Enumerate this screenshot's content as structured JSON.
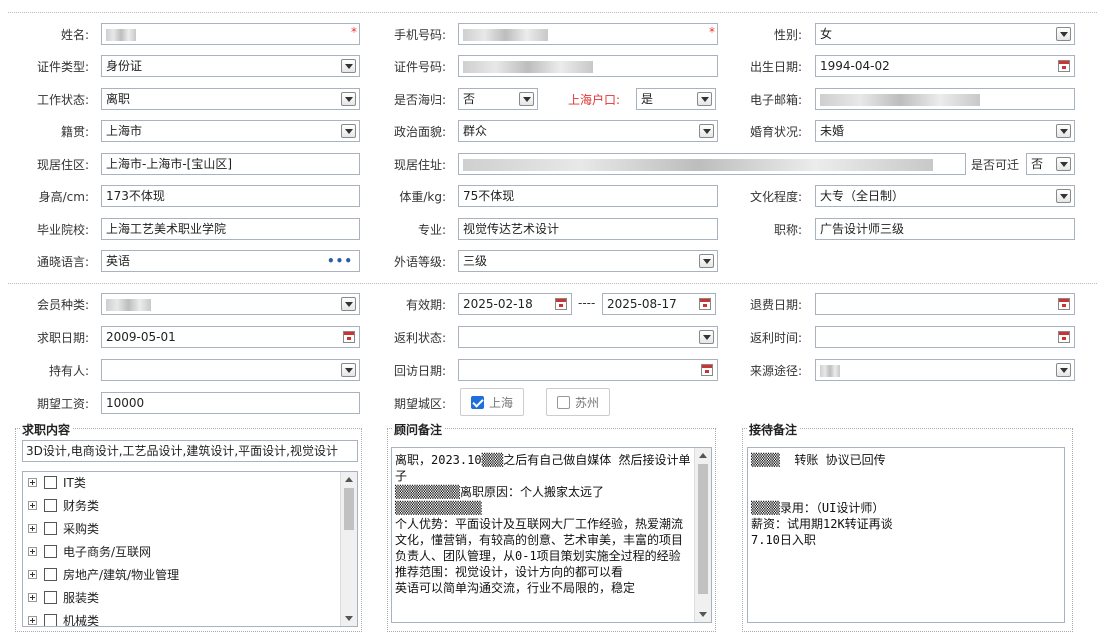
{
  "personal": {
    "name": {
      "label": "姓名:"
    },
    "phone": {
      "label": "手机号码:"
    },
    "gender": {
      "label": "性别:",
      "value": "女"
    },
    "id_type": {
      "label": "证件类型:",
      "value": "身份证"
    },
    "id_no": {
      "label": "证件号码:"
    },
    "birth": {
      "label": "出生日期:",
      "value": "1994-04-02"
    },
    "work_status": {
      "label": "工作状态:",
      "value": "离职"
    },
    "overseas": {
      "label": "是否海归:",
      "value": "否"
    },
    "sh_hukou": {
      "label": "上海户口:",
      "value": "是"
    },
    "email": {
      "label": "电子邮箱:"
    },
    "native": {
      "label": "籍贯:",
      "value": "上海市"
    },
    "politics": {
      "label": "政治面貌:",
      "value": "群众"
    },
    "marital": {
      "label": "婚育状况:",
      "value": "未婚"
    },
    "residence": {
      "label": "现居住区:",
      "value": "上海市-上海市-[宝山区]"
    },
    "address": {
      "label": "现居住址:"
    },
    "relocate": {
      "label": "是否可迁",
      "value": "否"
    },
    "height": {
      "label": "身高/cm:",
      "value": "173不体现"
    },
    "weight": {
      "label": "体重/kg:",
      "value": "75不体现"
    },
    "education": {
      "label": "文化程度:",
      "value": "大专（全日制）"
    },
    "school": {
      "label": "毕业院校:",
      "value": "上海工艺美术职业学院"
    },
    "major": {
      "label": "专业:",
      "value": "视觉传达艺术设计"
    },
    "title": {
      "label": "职称:",
      "value": "广告设计师三级"
    },
    "language": {
      "label": "通晓语言:",
      "value": "英语",
      "more": "•••"
    },
    "lang_level": {
      "label": "外语等级:",
      "value": "三级"
    }
  },
  "membership": {
    "member_type": {
      "label": "会员种类:"
    },
    "validity": {
      "label": "有效期:",
      "from": "2025-02-18",
      "sep": "----",
      "to": "2025-08-17"
    },
    "refund_date": {
      "label": "退费日期:"
    },
    "apply_date": {
      "label": "求职日期:",
      "value": "2009-05-01"
    },
    "rebate_status": {
      "label": "返利状态:"
    },
    "rebate_time": {
      "label": "返利时间:"
    },
    "holder": {
      "label": "持有人:"
    },
    "visit_date": {
      "label": "回访日期:"
    },
    "source": {
      "label": "来源途径:"
    },
    "salary": {
      "label": "期望工资:",
      "value": "10000"
    },
    "city": {
      "label": "期望城区:",
      "options": [
        {
          "label": "上海",
          "checked": true
        },
        {
          "label": "苏州",
          "checked": false
        }
      ]
    }
  },
  "job_panel": {
    "title": "求职内容",
    "summary": "3D设计,电商设计,工艺品设计,建筑设计,平面设计,视觉设计",
    "items": [
      "IT类",
      "财务类",
      "采购类",
      "电子商务/互联网",
      "房地产/建筑/物业管理",
      "服装类",
      "机械类"
    ]
  },
  "advisor_panel": {
    "title": "顾问备注",
    "text": "离职，2023.10▒▒▒之后有自己做自媒体 然后接设计单子\n▒▒▒▒▒▒▒▒▒离职原因：个人搬家太远了\n▒▒▒▒▒▒▒▒▒▒▒▒\n个人优势：平面设计及互联网大厂工作经验，热爱潮流文化，懂营销，有较高的创意、艺术审美，丰富的项目负责人、团队管理，从0-1项目策划实施全过程的经验\n推荐范围：视觉设计，设计方向的都可以看\n英语可以简单沟通交流，行业不局限的，稳定"
  },
  "reception_panel": {
    "title": "接待备注",
    "text": "▒▒▒▒  转账 协议已回传\n\n\n▒▒▒▒录用：（UI设计师）\n薪资：试用期12K转证再谈\n7.10日入职"
  },
  "colors": {
    "required": "#e33333",
    "hukou_label": "#e33333",
    "checkbox_on": "#1e6fd9"
  }
}
